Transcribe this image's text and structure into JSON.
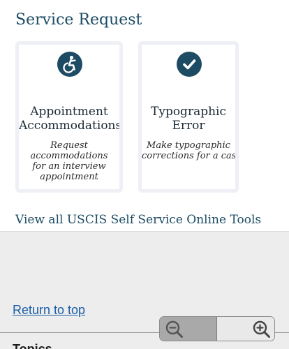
{
  "section": {
    "title": "Service Request"
  },
  "cards": [
    {
      "icon": "accessibility-icon",
      "title_lines": [
        "Appointment",
        "Accommodations"
      ],
      "description_lines": [
        "Request",
        "accommodations",
        "for an interview",
        "appointment"
      ]
    },
    {
      "icon": "check-circle-icon",
      "title_lines": [
        "Typographic",
        "Error"
      ],
      "description_lines": [
        "Make typographic",
        "corrections for a case"
      ]
    }
  ],
  "links": {
    "view_all": "View all USCIS Self Service Online Tools",
    "return_to_top": "Return to top"
  },
  "footer": {
    "topics_label": "Topics"
  },
  "zoom": {
    "out_icon": "zoom-out-icon",
    "in_icon": "zoom-in-icon"
  },
  "colors": {
    "brand": "#1c4b63",
    "link": "#1a5ea8",
    "card_border": "#eef0f6",
    "page_background": "#ededed"
  }
}
